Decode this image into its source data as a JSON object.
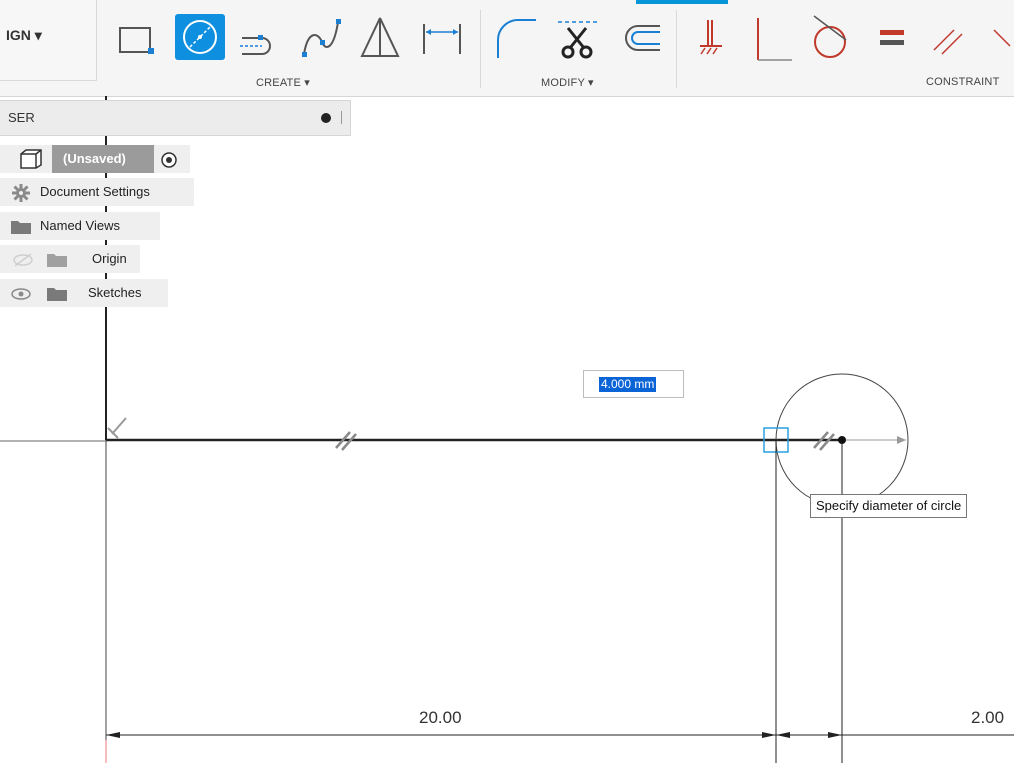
{
  "toolbar": {
    "workspace_label": "IGN ▾",
    "groups": {
      "create": "CREATE ▾",
      "modify": "MODIFY ▾",
      "constraint": "CONSTRAINT"
    },
    "accent_color": "#0696d7",
    "tools": [
      {
        "icon": "rectangle-icon"
      },
      {
        "icon": "circle-icon",
        "active": true
      },
      {
        "icon": "slot-icon"
      },
      {
        "icon": "spline-icon"
      },
      {
        "icon": "mirror-triangle-icon"
      },
      {
        "icon": "dimension-icon"
      },
      {
        "icon": "fillet-icon"
      },
      {
        "icon": "trim-scissors-icon"
      },
      {
        "icon": "offset-icon"
      },
      {
        "icon": "fix-constraint-icon"
      },
      {
        "icon": "perpendicular-icon"
      },
      {
        "icon": "tangent-icon"
      },
      {
        "icon": "equal-icon"
      },
      {
        "icon": "parallel-icon"
      }
    ]
  },
  "browser": {
    "title": "SER",
    "items": [
      {
        "label": "(Unsaved)",
        "icon": "component-icon"
      },
      {
        "label": "Document Settings",
        "icon": "gear-icon"
      },
      {
        "label": "Named Views",
        "icon": "folder-icon"
      },
      {
        "label": "Origin",
        "icon": "folder-icon"
      },
      {
        "label": "Sketches",
        "icon": "folder-icon"
      }
    ]
  },
  "sketch": {
    "diameter_input": "4.000 mm",
    "tooltip": "Specify diameter of circle",
    "dimension_left": "20.00",
    "dimension_right": "2.00"
  }
}
